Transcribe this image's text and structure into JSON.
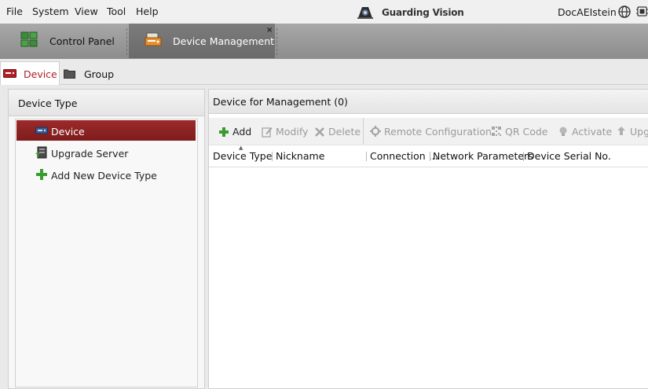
{
  "menu": {
    "items": [
      "File",
      "System",
      "View",
      "Tool",
      "Help"
    ]
  },
  "app": {
    "title": "Guarding Vision",
    "username": "DocAEIstein",
    "icons": [
      "app-logo-icon",
      "globe-icon",
      "cpu-icon"
    ]
  },
  "module_tabs": [
    {
      "label": "Control Panel",
      "icon": "control-panel-icon",
      "active": false
    },
    {
      "label": "Device Management",
      "icon": "device-management-icon",
      "active": true
    }
  ],
  "module_tab_close": "×",
  "sub_tabs": [
    {
      "label": "Device",
      "icon": "device-icon",
      "active": true
    },
    {
      "label": "Group",
      "icon": "folder-icon",
      "active": false
    }
  ],
  "left_panel": {
    "title": "Device Type",
    "items": [
      {
        "label": "Device",
        "icon": "device-icon",
        "selected": true
      },
      {
        "label": "Upgrade Server",
        "icon": "upgrade-server-icon",
        "selected": false
      },
      {
        "label": "Add New Device Type",
        "icon": "plus-icon",
        "selected": false
      }
    ]
  },
  "right_panel": {
    "title": "Device for Management (0)",
    "toolbar": [
      {
        "label": "Add",
        "icon": "plus-icon",
        "enabled": true
      },
      {
        "label": "Modify",
        "icon": "edit-icon",
        "enabled": false
      },
      {
        "label": "Delete",
        "icon": "delete-icon",
        "enabled": false
      },
      {
        "label": "Remote Configuration",
        "icon": "gear-icon",
        "enabled": false
      },
      {
        "label": "QR Code",
        "icon": "qr-code-icon",
        "enabled": false
      },
      {
        "label": "Activate",
        "icon": "bulb-icon",
        "enabled": false
      },
      {
        "label": "Upg",
        "icon": "upload-icon",
        "enabled": false
      }
    ],
    "columns": [
      "Device Type",
      "Nickname",
      "Connection ...",
      "Network Parameters",
      "Device Serial No."
    ],
    "rows": []
  },
  "colors": {
    "accent_red": "#9c2a2a",
    "add_green": "#3a9b2e",
    "tab_bar_gray": "#8c8c8c"
  }
}
